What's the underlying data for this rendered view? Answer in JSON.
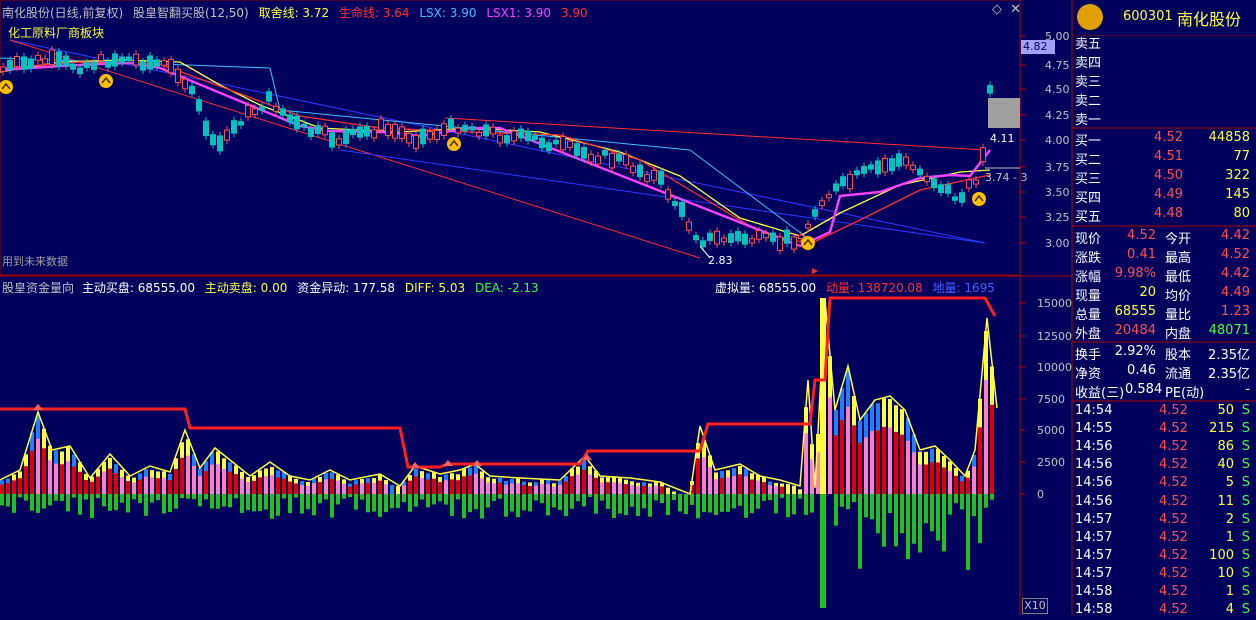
{
  "header": {
    "stock_title": "南化股份(日线,前复权)",
    "indicator_name": "股皇智翻买股(12,50)",
    "qushe": "取舍线: 3.72",
    "shengming": "生命线: 3.64",
    "lsx": "LSX: 3.90",
    "lsx1": "LSX1: 3.90",
    "extra": "3.90",
    "sector_label": "化工原料厂商板块",
    "future_data_note": "用到未来数据"
  },
  "main_chart": {
    "price_axis": [
      "5.00",
      "4.75",
      "4.50",
      "4.25",
      "4.00",
      "3.75",
      "3.50",
      "3.25",
      "3.00"
    ],
    "current_price_tag": "4.82",
    "high_marker": "4.11",
    "low_marker": "2.83",
    "right_label": "3.74 - 3"
  },
  "sub_chart": {
    "indicator_name": "股皇资金量向",
    "zhudong_mai": "主动买盘: 68555.00",
    "zhudong_maipan": "主动卖盘: 0.00",
    "zijin": "资金异动: 177.58",
    "diff": "DIFF: 5.03",
    "dea": "DEA: -2.13",
    "xuni": "虚拟量: 68555.00",
    "dongliang": "动量: 138720.08",
    "diliang": "地量: 1695",
    "volume_axis": [
      "15000",
      "12500",
      "10000",
      "7500",
      "5000",
      "2500",
      "0"
    ],
    "zoom": "X10"
  },
  "panel": {
    "code": "600301",
    "name": "南化股份",
    "sell": [
      {
        "label": "卖五",
        "price": "",
        "qty": ""
      },
      {
        "label": "卖四",
        "price": "",
        "qty": ""
      },
      {
        "label": "卖三",
        "price": "",
        "qty": ""
      },
      {
        "label": "卖二",
        "price": "",
        "qty": ""
      },
      {
        "label": "卖一",
        "price": "",
        "qty": ""
      }
    ],
    "buy": [
      {
        "label": "买一",
        "price": "4.52",
        "qty": "44858"
      },
      {
        "label": "买二",
        "price": "4.51",
        "qty": "77"
      },
      {
        "label": "买三",
        "price": "4.50",
        "qty": "322"
      },
      {
        "label": "买四",
        "price": "4.49",
        "qty": "145"
      },
      {
        "label": "买五",
        "price": "4.48",
        "qty": "80"
      }
    ],
    "quote": [
      {
        "l1": "现价",
        "v1": "4.52",
        "c1": "#ff5050",
        "l2": "今开",
        "v2": "4.42",
        "c2": "#ff5050"
      },
      {
        "l1": "涨跌",
        "v1": "0.41",
        "c1": "#ff5050",
        "l2": "最高",
        "v2": "4.52",
        "c2": "#ff5050"
      },
      {
        "l1": "涨幅",
        "v1": "9.98%",
        "c1": "#ff5050",
        "l2": "最低",
        "v2": "4.42",
        "c2": "#ff5050"
      },
      {
        "l1": "现量",
        "v1": "20",
        "c1": "#ffff40",
        "l2": "均价",
        "v2": "4.49",
        "c2": "#ff5050"
      },
      {
        "l1": "总量",
        "v1": "68555",
        "c1": "#ffff40",
        "l2": "量比",
        "v2": "1.23",
        "c2": "#ff5050"
      },
      {
        "l1": "外盘",
        "v1": "20484",
        "c1": "#ff5050",
        "l2": "内盘",
        "v2": "48071",
        "c2": "#40ff40"
      }
    ],
    "stats": [
      {
        "l1": "换手",
        "v1": "2.92%",
        "l2": "股本",
        "v2": "2.35亿"
      },
      {
        "l1": "净资",
        "v1": "0.46",
        "l2": "流通",
        "v2": "2.35亿"
      }
    ],
    "pe_row": {
      "l1": "收益(三)",
      "v1": "0.584",
      "l2": "PE(动)",
      "v2": "-"
    },
    "ticks": [
      {
        "time": "14:54",
        "price": "4.52",
        "vol": "50",
        "side": "S"
      },
      {
        "time": "14:55",
        "price": "4.52",
        "vol": "215",
        "side": "S"
      },
      {
        "time": "14:56",
        "price": "4.52",
        "vol": "86",
        "side": "S"
      },
      {
        "time": "14:56",
        "price": "4.52",
        "vol": "40",
        "side": "S"
      },
      {
        "time": "14:56",
        "price": "4.52",
        "vol": "5",
        "side": "S"
      },
      {
        "time": "14:56",
        "price": "4.52",
        "vol": "11",
        "side": "S"
      },
      {
        "time": "14:57",
        "price": "4.52",
        "vol": "2",
        "side": "S"
      },
      {
        "time": "14:57",
        "price": "4.52",
        "vol": "1",
        "side": "S"
      },
      {
        "time": "14:57",
        "price": "4.52",
        "vol": "100",
        "side": "S"
      },
      {
        "time": "14:57",
        "price": "4.52",
        "vol": "10",
        "side": "S"
      },
      {
        "time": "14:58",
        "price": "4.52",
        "vol": "1",
        "side": "S"
      },
      {
        "time": "14:58",
        "price": "4.52",
        "vol": "4",
        "side": "S"
      }
    ]
  },
  "colors": {
    "background": "#00005c",
    "up": "#ff5050",
    "down": "#00c0c0",
    "yellow": "#ffff40",
    "green": "#40ff40"
  }
}
